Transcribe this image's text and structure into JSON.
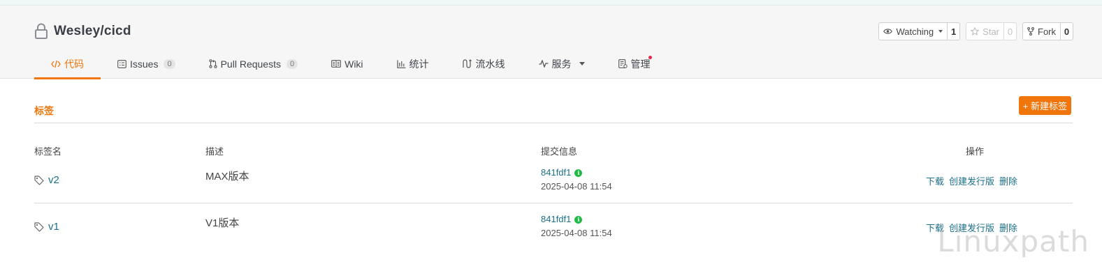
{
  "repo": {
    "path": "Wesley/cicd"
  },
  "actions": {
    "watch": {
      "label": "Watching",
      "count": "1"
    },
    "star": {
      "label": "Star",
      "count": "0"
    },
    "fork": {
      "label": "Fork",
      "count": "0"
    }
  },
  "tabs": [
    {
      "label": "代码",
      "icon": "code-icon",
      "active": true
    },
    {
      "label": "Issues",
      "badge": "0",
      "icon": "issues-icon"
    },
    {
      "label": "Pull Requests",
      "badge": "0",
      "icon": "pull-request-icon"
    },
    {
      "label": "Wiki",
      "icon": "book-icon"
    },
    {
      "label": "统计",
      "icon": "bar-chart-icon"
    },
    {
      "label": "流水线",
      "icon": "pipeline-icon"
    },
    {
      "label": "服务",
      "icon": "pulse-icon"
    },
    {
      "label": "管理",
      "icon": "settings-doc-icon"
    }
  ],
  "section": {
    "title": "标签",
    "new_button": "+ 新建标签"
  },
  "table": {
    "headers": {
      "name": "标签名",
      "desc": "描述",
      "commit": "提交信息",
      "ops": "操作"
    },
    "rows": [
      {
        "name": "v2",
        "desc": "MAX版本",
        "sha": "841fdf1",
        "date": "2025-04-08 11:54",
        "download": "下载",
        "release": "创建发行版",
        "delete": "删除"
      },
      {
        "name": "v1",
        "desc": "V1版本",
        "sha": "841fdf1",
        "date": "2025-04-08 11:54",
        "download": "下载",
        "release": "创建发行版",
        "delete": "删除"
      }
    ]
  },
  "watermark": "Linuxpath",
  "colors": {
    "accent": "#f0760c",
    "link": "#1c6f8a",
    "notify_dot": "#e5274b",
    "verified": "#21ba45"
  }
}
